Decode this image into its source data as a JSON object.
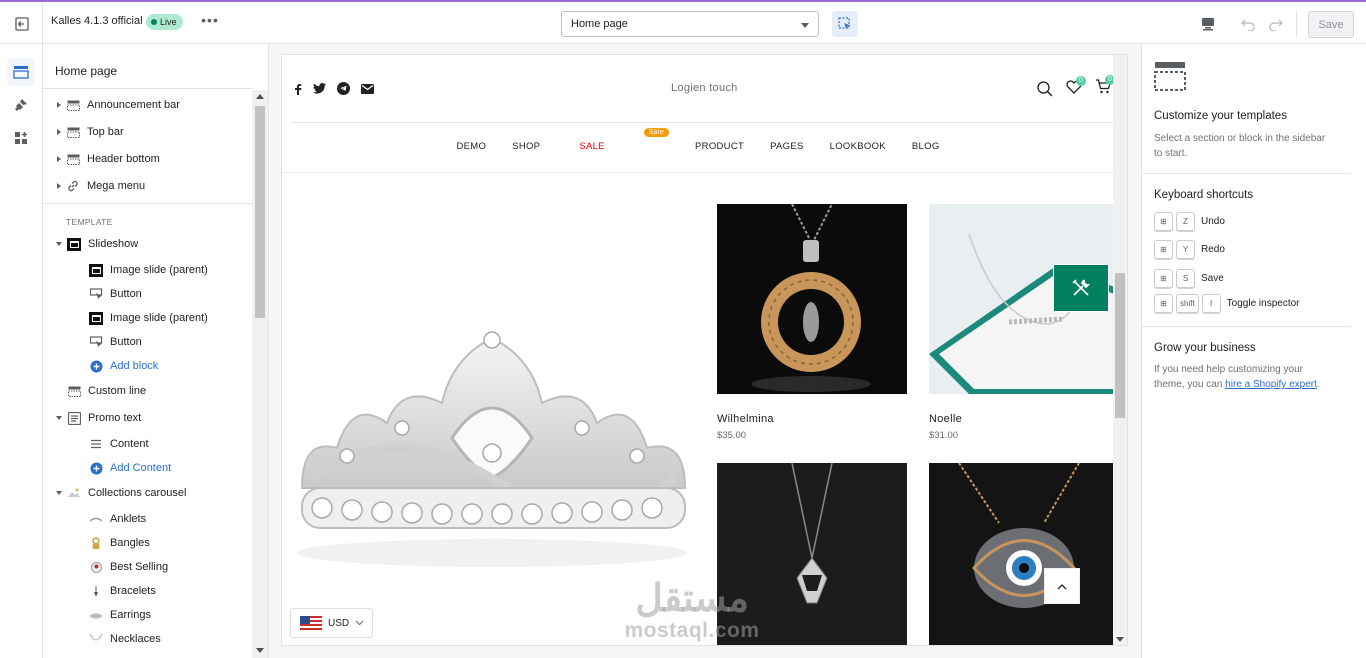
{
  "topbar": {
    "theme_name": "Kalles 4.1.3 official",
    "live_badge": "Live",
    "more": "•••",
    "page_select": "Home page",
    "save_label": "Save"
  },
  "sidebar": {
    "title": "Home page",
    "header_items": [
      {
        "label": "Announcement bar",
        "icon": "section-icon"
      },
      {
        "label": "Top bar",
        "icon": "section-icon"
      },
      {
        "label": "Header bottom",
        "icon": "section-icon"
      },
      {
        "label": "Mega menu",
        "icon": "link-icon"
      }
    ],
    "template_label": "TEMPLATE",
    "slideshow": "Slideshow",
    "slideshow_children": [
      "Image slide (parent)",
      "Button",
      "Image slide (parent)",
      "Button"
    ],
    "add_block": "Add block",
    "custom_line": "Custom line",
    "promo_text": "Promo text",
    "promo_child": "Content",
    "add_content": "Add Content",
    "collections": "Collections carousel",
    "collection_items": [
      "Anklets",
      "Bangles",
      "Best Selling",
      "Bracelets",
      "Earrings",
      "Necklaces"
    ]
  },
  "preview": {
    "logo": "Logien touch",
    "nav": [
      "DEMO",
      "SHOP",
      "SALE",
      "PRODUCT",
      "PAGES",
      "LOOKBOOK",
      "BLOG"
    ],
    "sale_badge": "Sale",
    "wishlist_count": "0",
    "cart_count": "0",
    "products": [
      {
        "name": "Wilhelmina",
        "price": "$35.00"
      },
      {
        "name": "Noelle",
        "price": "$31.00"
      }
    ],
    "currency": "USD",
    "watermark_ar": "مستقل",
    "watermark_en": "mostaql.com"
  },
  "right_panel": {
    "title": "Customize your templates",
    "desc": "Select a section or block in the sidebar to start.",
    "shortcuts_title": "Keyboard shortcuts",
    "shortcuts": [
      {
        "keys": [
          "Z"
        ],
        "label": "Undo"
      },
      {
        "keys": [
          "Y"
        ],
        "label": "Redo"
      },
      {
        "keys": [
          "S"
        ],
        "label": "Save"
      },
      {
        "keys": [
          "shift",
          "I"
        ],
        "label": "Toggle inspector"
      }
    ],
    "grow_title": "Grow your business",
    "grow_text_1": "If you need help customizing your theme, you can ",
    "grow_link": "hire a Shopify expert",
    "grow_text_2": "."
  },
  "colors": {
    "accent": "#008060",
    "link": "#2c6ecb",
    "sale": "#ec0101",
    "sale_badge": "#f69c0c"
  }
}
